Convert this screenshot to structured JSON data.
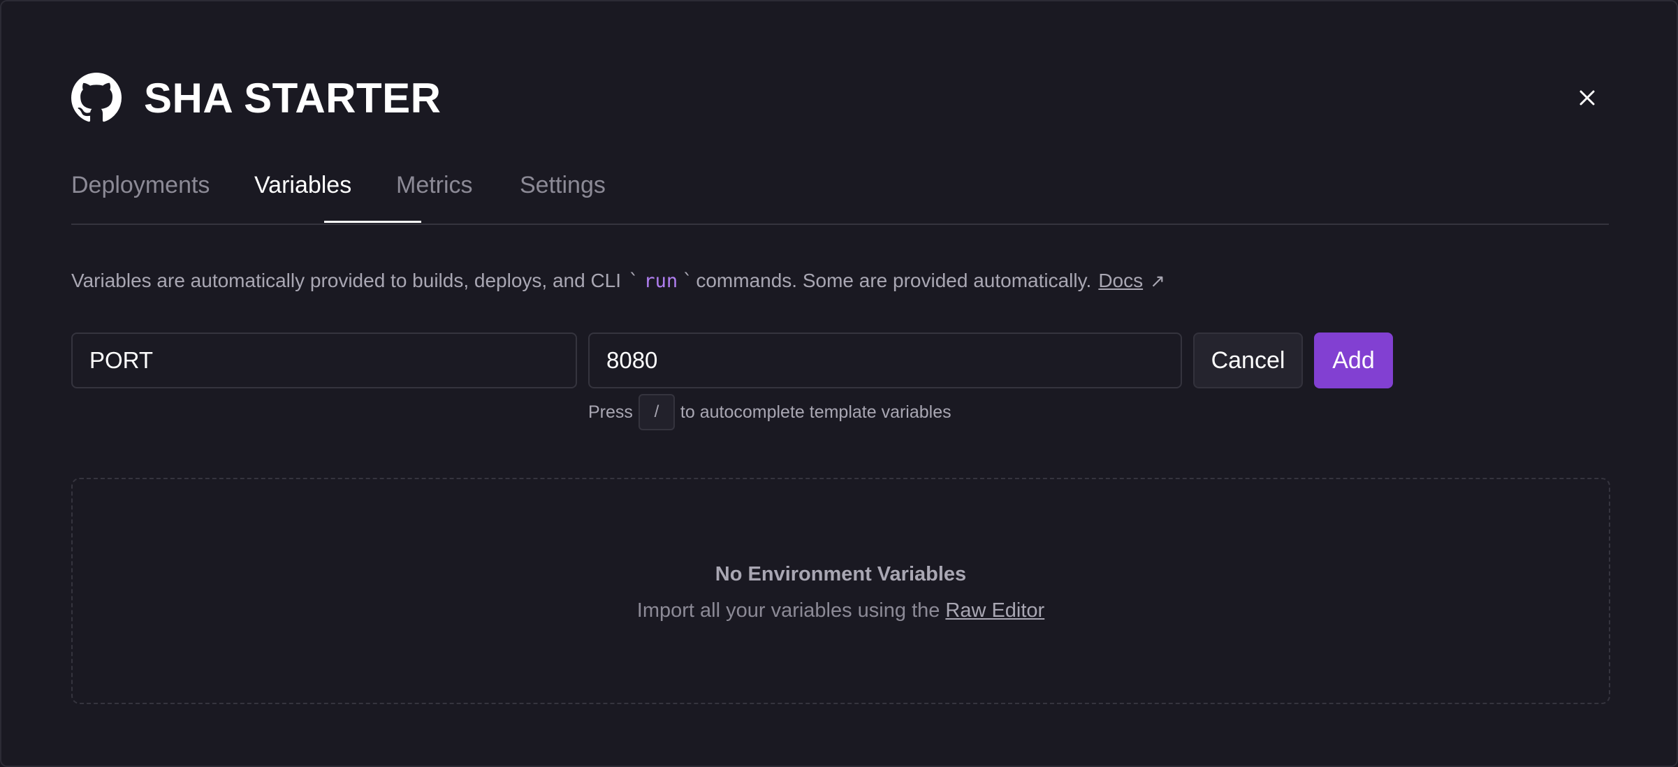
{
  "header": {
    "title": "SHA STARTER",
    "icon": "github-icon",
    "close_icon": "close-icon"
  },
  "tabs": [
    {
      "label": "Deployments",
      "active": false
    },
    {
      "label": "Variables",
      "active": true
    },
    {
      "label": "Metrics",
      "active": false
    },
    {
      "label": "Settings",
      "active": false
    }
  ],
  "description": {
    "text_before": "Variables are automatically provided to builds, deploys, and CLI",
    "code": "run",
    "text_after": "commands. Some are provided automatically.",
    "docs_link": "Docs",
    "external_icon": "arrow-up-right-icon"
  },
  "form": {
    "name_value": "PORT",
    "value_value": "8080",
    "cancel_label": "Cancel",
    "add_label": "Add"
  },
  "hint": {
    "before": "Press",
    "key": "/",
    "after": "to autocomplete template variables"
  },
  "empty_state": {
    "title": "No Environment Variables",
    "subtitle": "Import all your variables using the",
    "link": "Raw Editor"
  },
  "colors": {
    "background": "#1a1922",
    "accent": "#8240d2",
    "code": "#b07ef0",
    "muted_text": "#a9a7b3"
  }
}
